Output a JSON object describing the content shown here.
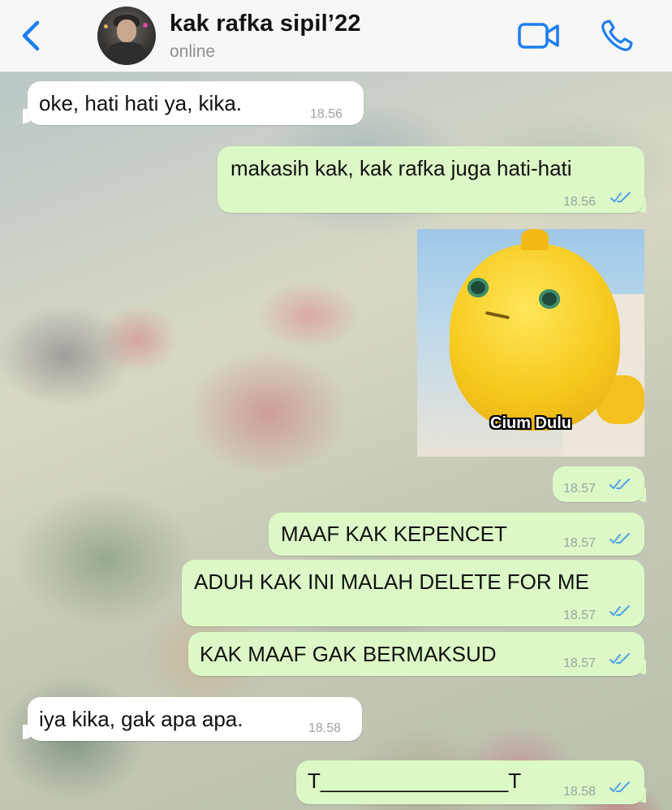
{
  "header": {
    "contact_name": "kak rafka sipil’22",
    "status": "online",
    "back_icon": "chevron-left-icon",
    "video_icon": "video-camera-icon",
    "call_icon": "phone-icon",
    "accent_color": "#1e7ef0"
  },
  "messages": [
    {
      "direction": "in",
      "text": "oke, hati hati ya, kika.",
      "time": "18.56"
    },
    {
      "direction": "out",
      "text": "makasih kak, kak rafka juga hati-hati",
      "time": "18.56",
      "read": true
    },
    {
      "direction": "out",
      "type": "sticker",
      "caption": "Cium Dulu"
    },
    {
      "direction": "out",
      "text": "",
      "time": "18.57",
      "read": true
    },
    {
      "direction": "out",
      "text": "MAAF KAK KEPENCET",
      "time": "18.57",
      "read": true
    },
    {
      "direction": "out",
      "text": "ADUH KAK INI MALAH DELETE FOR ME",
      "time": "18.57",
      "read": true
    },
    {
      "direction": "out",
      "text": "KAK MAAF GAK BERMAKSUD",
      "time": "18.57",
      "read": true
    },
    {
      "direction": "in",
      "text": "iya kika, gak apa apa.",
      "time": "18.58"
    },
    {
      "direction": "out",
      "text": "T________________T",
      "time": "18.58",
      "read": true
    }
  ],
  "colors": {
    "incoming_bubble": "#ffffff",
    "outgoing_bubble": "#dcf8c6",
    "read_ticks": "#4fa3e8"
  }
}
